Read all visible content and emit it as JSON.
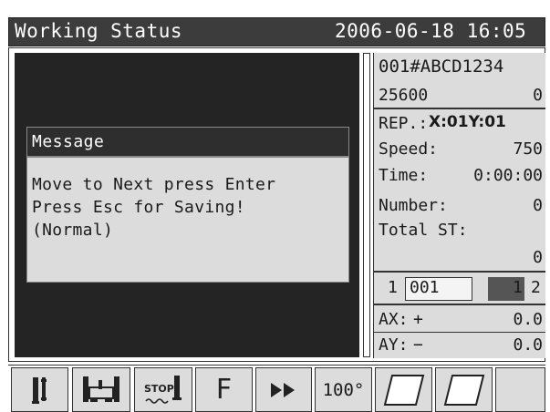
{
  "header": {
    "title": "Working Status",
    "datetime": "2006-06-18 16:05"
  },
  "message": {
    "title": "Message",
    "lines": [
      "Move to Next press Enter",
      "Press Esc for Saving!",
      "(Normal)"
    ]
  },
  "status": {
    "pattern_name": "001#ABCD1234",
    "stitch_count_label": "25600",
    "stitch_count_value": "0",
    "rep_label": "REP.:",
    "rep_value": "X:01Y:01",
    "speed_label": "Speed:",
    "speed_value": "750",
    "time_label": "Time:",
    "time_value": "0:00:00",
    "number_label": "Number:",
    "number_value": "0",
    "total_st_label": "Total ST:",
    "total_st_value": "0",
    "counter_left": "1",
    "counter_box": "001",
    "counter_hl": "1",
    "counter_right": "2",
    "ax_label": "AX:",
    "ax_sign": "+",
    "ax_value": "0.0",
    "ay_label": "AY:",
    "ay_sign": "−",
    "ay_value": "0.0"
  },
  "toolbar": {
    "buttons": [
      {
        "icon": "needle-pin-icon"
      },
      {
        "icon": "frame-needle-icon"
      },
      {
        "icon": "stop-icon",
        "label": "STOP"
      },
      {
        "icon": "f-letter-icon",
        "label": "F"
      },
      {
        "icon": "fast-forward-icon"
      },
      {
        "label": "100°"
      },
      {
        "icon": "parallelogram-icon"
      },
      {
        "icon": "parallelogram-icon"
      }
    ]
  }
}
